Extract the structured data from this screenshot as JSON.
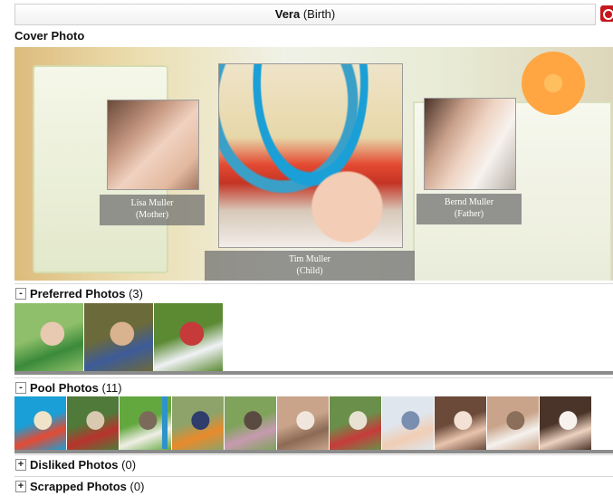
{
  "window": {
    "name": "Vera",
    "suffix": " (Birth)"
  },
  "cover": {
    "label": "Cover Photo",
    "people": [
      {
        "name": "Lisa Muller",
        "role": "(Mother)"
      },
      {
        "name": "Tim Muller",
        "role": "(Child)"
      },
      {
        "name": "Bernd Muller",
        "role": "(Father)"
      }
    ]
  },
  "groups": [
    {
      "toggle": "-",
      "title": "Preferred Photos",
      "count": " (3)"
    },
    {
      "toggle": "-",
      "title": "Pool Photos",
      "count": " (11)"
    },
    {
      "toggle": "+",
      "title": "Disliked Photos",
      "count": " (0)"
    },
    {
      "toggle": "+",
      "title": "Scrapped Photos",
      "count": " (0)"
    }
  ],
  "preferred_photos": [
    {
      "icon": "baby-on-slide-photo",
      "colors": [
        "#8fbf6a",
        "#3a8a3a",
        "#e8c9b2"
      ]
    },
    {
      "icon": "baby-with-ball-photo",
      "colors": [
        "#6b6a3a",
        "#3d5b9a",
        "#d9b290"
      ]
    },
    {
      "icon": "baby-on-grass-photo",
      "colors": [
        "#5b8a33",
        "#f0f2f5",
        "#c63a3a"
      ]
    }
  ],
  "pool_photos": [
    {
      "icon": "baby-play-gym-photo",
      "colors": [
        "#1a9fd6",
        "#e44a32",
        "#efe4c9"
      ]
    },
    {
      "icon": "baby-rocking-horse-photo",
      "colors": [
        "#4f7a3a",
        "#b9332c",
        "#d8c9b0"
      ]
    },
    {
      "icon": "toddler-garden-photo",
      "colors": [
        "#63a83f",
        "#f0efe6",
        "#7b6a5a"
      ]
    },
    {
      "icon": "toddler-orange-shirt-photo",
      "colors": [
        "#8ea36a",
        "#e98a2c",
        "#2e3d6b"
      ]
    },
    {
      "icon": "toddler-with-parent-photo",
      "colors": [
        "#7fa35b",
        "#c79ab0",
        "#5a4a40"
      ]
    },
    {
      "icon": "toddler-house-photo",
      "colors": [
        "#c9a48a",
        "#8c6a55",
        "#f1e6dd"
      ]
    },
    {
      "icon": "toddler-toy-car-photo",
      "colors": [
        "#6a8f4a",
        "#c73b3b",
        "#e8e2d2"
      ]
    },
    {
      "icon": "baby-portrait-photo",
      "colors": [
        "#dfe6ee",
        "#f1cdb4",
        "#7a8fb0"
      ]
    },
    {
      "icon": "mother-and-baby-photo",
      "colors": [
        "#6b4a3a",
        "#e9c4ad",
        "#f3e1d6"
      ]
    },
    {
      "icon": "bunny-photo",
      "colors": [
        "#c9a48a",
        "#f5f2ee",
        "#8b6f5a"
      ]
    },
    {
      "icon": "father-and-baby-photo",
      "colors": [
        "#4a3328",
        "#edd2c0",
        "#f7f2ee"
      ]
    }
  ]
}
